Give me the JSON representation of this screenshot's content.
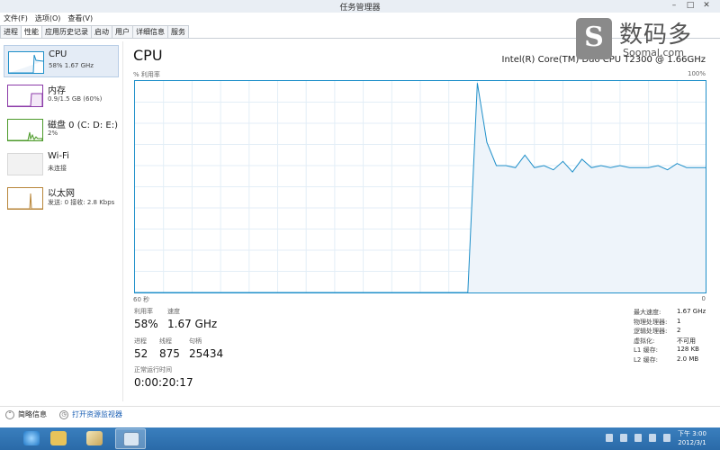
{
  "window": {
    "title": "任务管理器",
    "controls": {
      "minimize": "–",
      "maximize": "□",
      "close": "✕"
    }
  },
  "menu": [
    "文件(F)",
    "选项(O)",
    "查看(V)"
  ],
  "tabs": [
    "进程",
    "性能",
    "应用历史记录",
    "启动",
    "用户",
    "详细信息",
    "服务"
  ],
  "active_tab": 1,
  "sidebar": {
    "items": [
      {
        "name": "CPU",
        "sub": "58% 1.67 GHz",
        "selected": true
      },
      {
        "name": "内存",
        "sub": "0.9/1.5 GB (60%)"
      },
      {
        "name": "磁盘 0 (C: D: E:)",
        "sub": "2%"
      },
      {
        "name": "Wi-Fi",
        "sub": "未连接"
      },
      {
        "name": "以太网",
        "sub": "发送: 0 接收: 2.8 Kbps"
      }
    ]
  },
  "main": {
    "title": "CPU",
    "processor": "Intel(R) Core(TM) Duo CPU T2300 @ 1.66GHz",
    "y_label": "% 利用率",
    "y_max": "100%",
    "x_left": "60 秒",
    "x_right": "0"
  },
  "chart_data": {
    "type": "area",
    "xlim": [
      0,
      60
    ],
    "ylim": [
      0,
      100
    ],
    "x": [
      0,
      35,
      36,
      37,
      38,
      39,
      40,
      41,
      42,
      43,
      44,
      45,
      46,
      47,
      48,
      49,
      50,
      51,
      52,
      53,
      54,
      55,
      56,
      57,
      58,
      59,
      60
    ],
    "values": [
      0,
      0,
      99,
      71,
      60,
      60,
      59,
      65,
      59,
      60,
      58,
      62,
      57,
      63,
      59,
      60,
      59,
      60,
      59,
      59,
      59,
      60,
      58,
      61,
      59,
      59,
      59
    ],
    "grid": true,
    "color": "#1e8fc9",
    "fill": "#eef4fa"
  },
  "stats": {
    "util_label": "利用率",
    "util_value": "58%",
    "speed_label": "速度",
    "speed_value": "1.67 GHz",
    "proc_label": "进程",
    "proc_value": "52",
    "thread_label": "线程",
    "thread_value": "875",
    "handle_label": "句柄",
    "handle_value": "25434",
    "uptime_label": "正常运行时间",
    "uptime_value": "0:00:20:17"
  },
  "info": [
    {
      "k": "最大速度:",
      "v": "1.67 GHz"
    },
    {
      "k": "物理处理器:",
      "v": "1"
    },
    {
      "k": "逻辑处理器:",
      "v": "2"
    },
    {
      "k": "虚拟化:",
      "v": "不可用"
    },
    {
      "k": "L1 缓存:",
      "v": "128 KB"
    },
    {
      "k": "L2 缓存:",
      "v": "2.0 MB"
    }
  ],
  "footer": {
    "brief": "简略信息",
    "monitor": "打开资源监视器"
  },
  "taskbar": {
    "time": "下午 3:00",
    "date": "2012/3/1"
  },
  "watermark": {
    "logo": "S",
    "cn": "数码多",
    "en": "Soomal.com"
  }
}
